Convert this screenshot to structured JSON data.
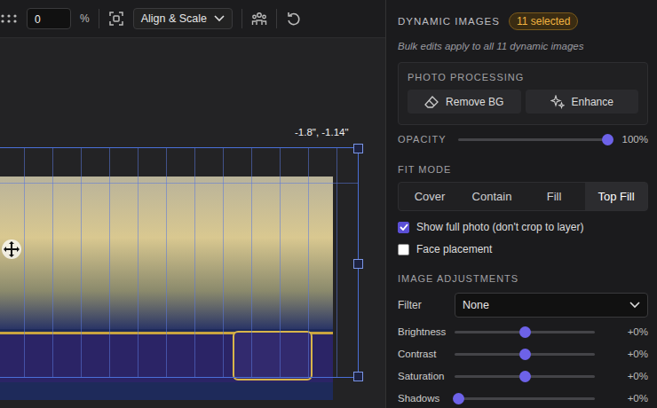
{
  "toolbar": {
    "spacing_value": "0",
    "unit": "%",
    "align_dropdown": "Align & Scale"
  },
  "canvas": {
    "coordinates": "-1.8\", -1.14\""
  },
  "panel": {
    "title": "DYNAMIC IMAGES",
    "badge": "11 selected",
    "note": "Bulk edits apply to all 11 dynamic images",
    "photo_processing": {
      "title": "PHOTO PROCESSING",
      "buttons": [
        "Remove BG",
        "Enhance"
      ]
    },
    "opacity": {
      "label": "OPACITY",
      "level": 1,
      "reading": "100%"
    },
    "fit_mode": {
      "label": "FIT MODE",
      "options": [
        {
          "label": "Cover",
          "selected": false
        },
        {
          "label": "Contain",
          "selected": false
        },
        {
          "label": "Fill",
          "selected": false
        },
        {
          "label": "Top Fill",
          "selected": true
        }
      ]
    },
    "checkboxes": [
      {
        "label": "Show full photo (don't crop to layer)",
        "checked": true
      },
      {
        "label": "Face placement",
        "checked": false
      }
    ],
    "image_adjustments": {
      "title": "IMAGE ADJUSTMENTS",
      "filter": {
        "label": "Filter",
        "value": "None"
      },
      "sliders": [
        {
          "label": "Brightness",
          "level": 0.5,
          "reading": "+0%"
        },
        {
          "label": "Contrast",
          "level": 0.5,
          "reading": "+0%"
        },
        {
          "label": "Saturation",
          "level": 0.5,
          "reading": "+0%"
        },
        {
          "label": "Shadows",
          "level": 0.03,
          "reading": "+0%"
        }
      ]
    }
  }
}
